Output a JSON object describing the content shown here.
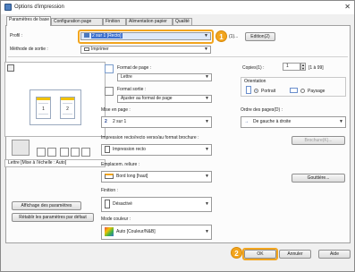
{
  "window": {
    "title": "Options d'impression"
  },
  "tabs": [
    {
      "label": "Paramètres de base"
    },
    {
      "label": "Configuration page"
    },
    {
      "label": "Finition"
    },
    {
      "label": "Alimentation papier"
    },
    {
      "label": "Qualité"
    }
  ],
  "profile": {
    "label": "Profil :",
    "value": "2 sur 1 [Recto]",
    "extra_label": "(1)...",
    "edit_button": "Edition(2)"
  },
  "output": {
    "label": "Méthode de sortie :",
    "value": "Imprimer"
  },
  "preview_caption": "Lettre [Mise à l'échelle : Auto]",
  "left_buttons": {
    "settings": "Affichage des paramètres",
    "defaults": "Rétablir les paramètres par défaut"
  },
  "page_format": {
    "label": "Format de page :",
    "value": "Lettre"
  },
  "output_format": {
    "label": "Format sortie :",
    "value": "Ajuster au format de page"
  },
  "layout": {
    "label": "Mise en page :",
    "value": "2 sur 1",
    "icon_text": "2"
  },
  "duplex": {
    "label": "Impression recto/recto verso/au format brochure :",
    "value": "Impression recto"
  },
  "binding": {
    "label": "Emplacem. reliure :",
    "value": "Bord long [haut]"
  },
  "finishing": {
    "label": "Finition :",
    "value": "Désactivé"
  },
  "color_mode": {
    "label": "Mode couleur :",
    "value": "Auto [Couleur/N&B]"
  },
  "copies": {
    "label": "Copies(1) :",
    "value": "1",
    "range": "[1 à 99]"
  },
  "orientation": {
    "group_label": "Orientation",
    "portrait": "Portrait",
    "landscape": "Paysage",
    "selected": "portrait"
  },
  "page_order": {
    "label": "Ordre des pages(D) :",
    "value": "De gauche à droite"
  },
  "booklet_button": "Brochure(K)...",
  "gutter_button": "Gouttière...",
  "preview_pages": [
    "1",
    "2"
  ],
  "footer": {
    "ok": "OK",
    "cancel": "Annuler",
    "help": "Aide"
  },
  "callouts": [
    "1",
    "2"
  ],
  "colors": {
    "accent": "#f2a51e",
    "selection": "#3b6fcf"
  }
}
